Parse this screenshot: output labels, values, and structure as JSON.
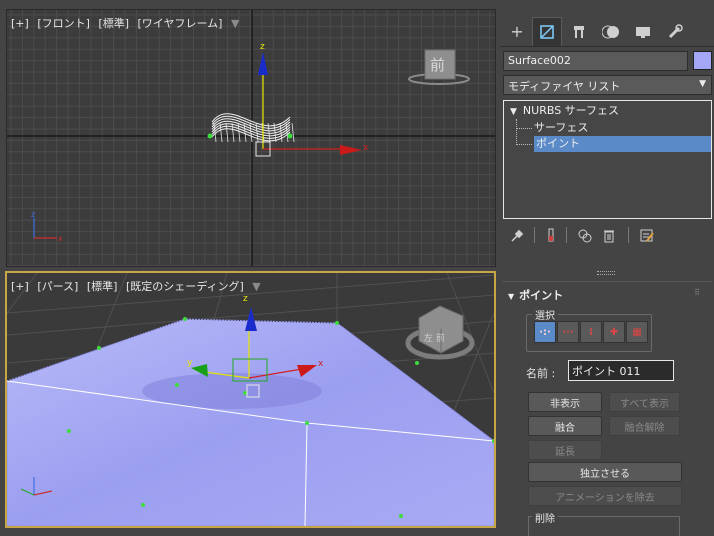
{
  "viewports": {
    "front": {
      "labels": [
        "[+]",
        "[フロント]",
        "[標準]",
        "[ワイヤフレーム]"
      ],
      "viewcube_label": "前"
    },
    "perspective": {
      "labels": [
        "[+]",
        "[パース]",
        "[標準]",
        "[既定のシェーディング]"
      ],
      "viewcube_label": "左 前"
    }
  },
  "axes": {
    "x": "x",
    "y": "y",
    "z": "z"
  },
  "panel": {
    "tabs": [
      "create-icon",
      "modify-icon",
      "hierarchy-icon",
      "motion-icon",
      "display-icon",
      "utilities-icon"
    ],
    "object_name": "Surface002",
    "object_color": "#a4a7f5",
    "modifier_list_label": "モディファイヤ リスト",
    "stack": {
      "root": "NURBS サーフェス",
      "children": [
        "サーフェス",
        "ポイント"
      ],
      "selected": "ポイント"
    },
    "rollout": {
      "title": "ポイント",
      "selection_group": "選択",
      "name_label": "名前 :",
      "name_value": "ポイント 011",
      "buttons": {
        "hide": "非表示",
        "unhide_all": "すべて表示",
        "fuse": "融合",
        "unfuse": "融合解除",
        "extend": "延長",
        "make_independent": "独立させる",
        "remove_animation": "アニメーションを除去"
      },
      "delete_group": "削除"
    }
  },
  "colors": {
    "accent": "#5b8ac8",
    "viewport_active_border": "#c8a646",
    "surface": "#a4a7f5"
  }
}
